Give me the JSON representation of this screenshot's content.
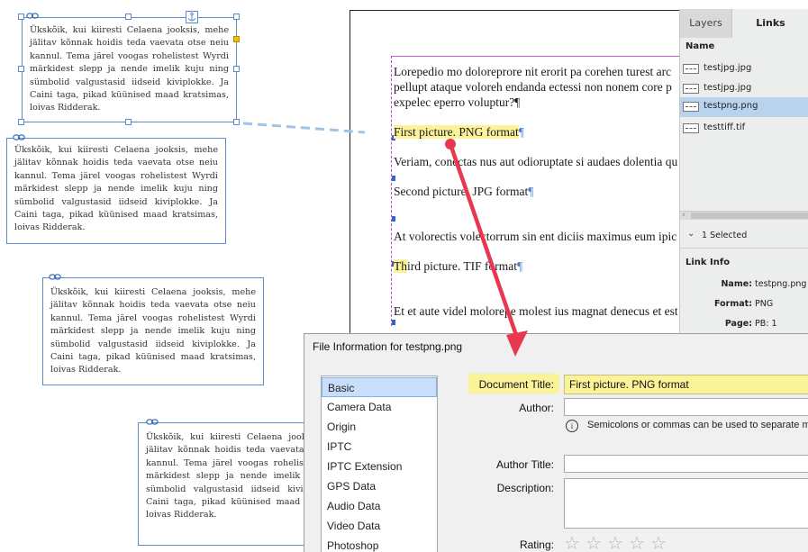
{
  "frame_text": "Ükskõik, kui kiiresti Celaena jooksis, mehe jälitav kõnnak hoidis teda vaevata otse neiu kannul. Tema järel voogas rohelistest Wyrdi märkidest slepp ja nende imelik kuju ning sümbolid valgustasid iidseid kiviplokke. Ja Caini taga, pikad küünised maad kratsimas, loivas Ridderak.",
  "document": {
    "paragraphs": [
      {
        "text": "Lorepedio mo doloreprore nit erorit pa corehen turest architatem pellupt ataque voloreh endanda ectessi non nonem core peliquam expelec eperro voluptur?",
        "lines": [
          "Lorepedio mo doloreprore nit erorit pa corehen turest arc",
          "pellupt ataque voloreh endanda ectessi non nonem core p",
          "expelec eperro voluptur?¶"
        ]
      },
      {
        "text": "First picture. PNG format",
        "pilcrow": "¶"
      },
      {
        "text": "Veriam, conectas nus aut odioruptate si audaes dolentia qu"
      },
      {
        "text": "Second picture. JPG format",
        "pilcrow": "¶"
      },
      {
        "text": "At volorectis volectorrum sin ent diciis maximus eum ipic"
      },
      {
        "pre": "Th",
        "text": "ird picture. TIF format",
        "pilcrow": "¶"
      },
      {
        "text": "Et et aute videl molorepe molest ius magnat denecus et est"
      }
    ]
  },
  "links_panel": {
    "tabs": [
      "Layers",
      "Links"
    ],
    "active_tab": "Links",
    "column_header": "Name",
    "files": [
      "testjpg.jpg",
      "testjpg.jpg",
      "testpng.png",
      "testtiff.tif"
    ],
    "selected_index": 2,
    "selection_status": "1 Selected",
    "link_info_title": "Link Info",
    "info": [
      {
        "key": "Name:",
        "value": "testpng.png"
      },
      {
        "key": "Format:",
        "value": "PNG"
      },
      {
        "key": "Page:",
        "value": "PB: 1"
      }
    ]
  },
  "dialog": {
    "title": "File Information for testpng.png",
    "categories": [
      "Basic",
      "Camera Data",
      "Origin",
      "IPTC",
      "IPTC Extension",
      "GPS Data",
      "Audio Data",
      "Video Data",
      "Photoshop"
    ],
    "active_category": "Basic",
    "fields": {
      "document_title_label": "Document Title:",
      "document_title_value": "First picture. PNG format",
      "author_label": "Author:",
      "author_value": "",
      "hint": "Semicolons or commas can be used to separate m",
      "author_title_label": "Author Title:",
      "author_title_value": "",
      "description_label": "Description:",
      "description_value": "",
      "rating_label": "Rating:"
    },
    "rating": 0,
    "rating_max": 5
  },
  "colors": {
    "highlight": "#fbf39a",
    "frame_border": "#5a8ccc",
    "callout_arrow": "#e8384f",
    "link_line": "#9fc4ea"
  }
}
